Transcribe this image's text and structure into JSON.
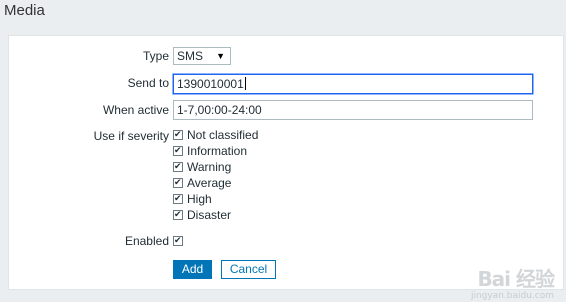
{
  "page": {
    "title": "Media"
  },
  "form": {
    "type": {
      "label": "Type",
      "value": "SMS"
    },
    "send_to": {
      "label": "Send to",
      "value": "1390010001"
    },
    "when_active": {
      "label": "When active",
      "value": "1-7,00:00-24:00"
    },
    "severity": {
      "label": "Use if severity",
      "options": [
        {
          "label": "Not classified",
          "checked": true
        },
        {
          "label": "Information",
          "checked": true
        },
        {
          "label": "Warning",
          "checked": true
        },
        {
          "label": "Average",
          "checked": true
        },
        {
          "label": "High",
          "checked": true
        },
        {
          "label": "Disaster",
          "checked": true
        }
      ]
    },
    "enabled": {
      "label": "Enabled",
      "checked": true
    },
    "buttons": {
      "add": "Add",
      "cancel": "Cancel"
    }
  },
  "watermark": {
    "text": "Bai 经验",
    "sub": "jingyan.baidu.com"
  }
}
